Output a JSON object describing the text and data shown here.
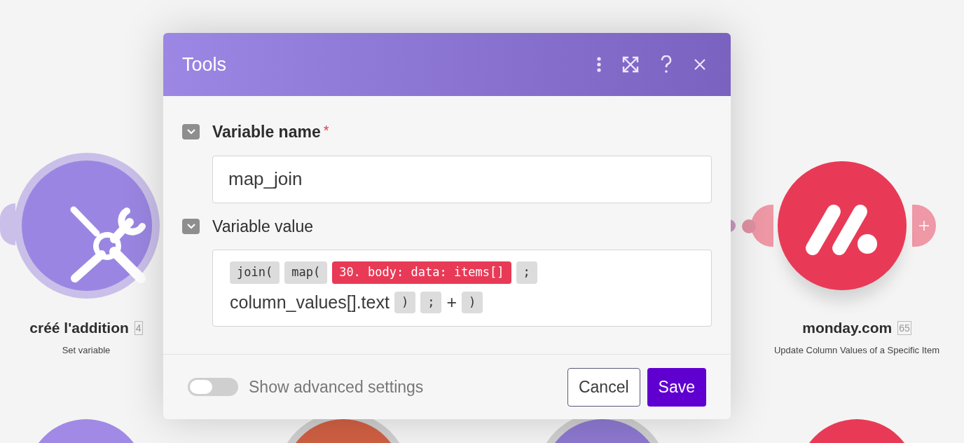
{
  "canvas": {
    "nodes": [
      {
        "kind": "tools",
        "title": "créé l'addition",
        "badge": "4",
        "subtitle": "Set variable"
      },
      {
        "kind": "monday",
        "title": "monday.com",
        "badge": "65",
        "subtitle": "Update Column Values of a Specific Item"
      }
    ]
  },
  "dialog": {
    "title": "Tools",
    "fields": [
      {
        "kind": "text",
        "label": "Variable name",
        "required": true,
        "required_mark": "*",
        "value": "map_join"
      },
      {
        "kind": "formula",
        "label": "Variable value",
        "required": false,
        "tokens": [
          {
            "kind": "func",
            "text": "join("
          },
          {
            "kind": "func",
            "text": "map("
          },
          {
            "kind": "item",
            "text": "30. body: data: items[]"
          },
          {
            "kind": "func",
            "text": ";"
          },
          {
            "kind": "text",
            "text": "column_values[].text"
          },
          {
            "kind": "func",
            "text": ")"
          },
          {
            "kind": "func",
            "text": ";"
          },
          {
            "kind": "text",
            "text": "+"
          },
          {
            "kind": "func",
            "text": ")"
          }
        ]
      }
    ],
    "advanced_toggle": {
      "label": "Show advanced settings",
      "on": false
    },
    "buttons": [
      {
        "kind": "secondary",
        "label": "Cancel"
      },
      {
        "kind": "primary",
        "label": "Save"
      }
    ]
  }
}
